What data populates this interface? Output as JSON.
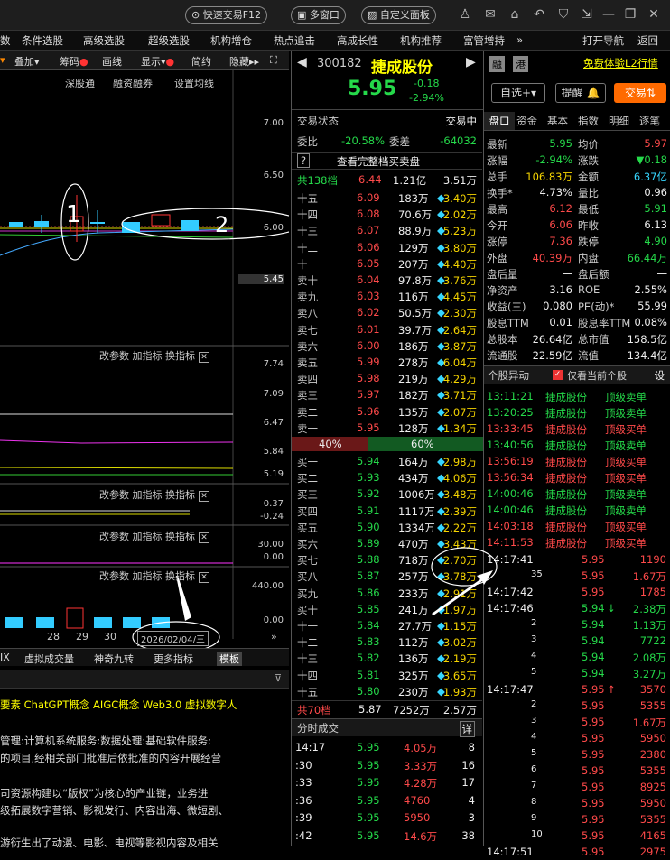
{
  "topbar": {
    "quick_trade": "快速交易F12",
    "multi_window": "多窗口",
    "custom_panel": "自定义面板"
  },
  "menu": [
    "数",
    "条件选股",
    "高级选股",
    "超级选股",
    "机构增仓",
    "热点追击",
    "高成长性",
    "机构推荐",
    "富管增持",
    "»",
    "打开导航",
    "返回"
  ],
  "chartbar": {
    "overlay": "叠加",
    "chips": "筹码",
    "draw": "画线",
    "display": "显示",
    "simple": "简约",
    "hide": "隐藏"
  },
  "chart": {
    "sub_tabs": [
      "深股通",
      "融资融券",
      "设置均线"
    ],
    "price_labels": [
      "7.00",
      "6.50",
      "6.00",
      "5.45"
    ],
    "annot1": "1",
    "annot2": "2",
    "panel_ctrl": {
      "params": "改参数",
      "add": "加指标",
      "switch": "换指标"
    },
    "p2_labels": [
      "7.74",
      "7.09",
      "6.47",
      "5.84",
      "5.19"
    ],
    "p3_labels": [
      "0.37",
      "-0.24"
    ],
    "p4_labels": [
      "30.00",
      "0.00"
    ],
    "p5_labels": [
      "440.00",
      "0.00"
    ],
    "dates": [
      "28",
      "29",
      "30"
    ],
    "date_box": "2026/02/04/三",
    "model": "模板"
  },
  "bottom_tabs": [
    "IX",
    "虚拟成交量",
    "神奇九转",
    "更多指标",
    "模板"
  ],
  "news": [
    "要素 ChatGPT概念 AIGC概念 Web3.0 虚拟数字人",
    "管理:计算机系统服务:数据处理:基础软件服务:",
    "的项目,经相关部门批准后依批准的内容开展经营",
    "司资源构建以“版权”为核心的产业链，业务进",
    "级拓展数字营销、影视发行、内容出海、微短剧、",
    "游衍生出了动漫、电影、电视等影视内容及相关"
  ],
  "stock": {
    "code": "300182",
    "name": "捷成股份",
    "price": "5.95",
    "change": "-0.18",
    "pct": "-2.94%",
    "tag1": "融",
    "tag2": "港",
    "l2": "免费体验L2行情",
    "watch": "自选+",
    "alert": "提醒",
    "trade": "交易"
  },
  "order_status": {
    "label": "交易状态",
    "value": "交易中",
    "wb_label": "委比",
    "wb": "-20.58%",
    "wc_label": "委差",
    "wc": "-64032",
    "full": "查看完整档买卖盘"
  },
  "sell_total": {
    "label": "共138档",
    "price": "6.44",
    "amt": "1.21亿",
    "vol": "3.51万"
  },
  "asks": [
    [
      "十五",
      "6.09",
      "183万",
      "3.40万"
    ],
    [
      "十四",
      "6.08",
      "70.6万",
      "2.02万"
    ],
    [
      "十三",
      "6.07",
      "88.9万",
      "5.23万"
    ],
    [
      "十二",
      "6.06",
      "129万",
      "3.80万"
    ],
    [
      "十一",
      "6.05",
      "207万",
      "4.40万"
    ],
    [
      "卖十",
      "6.04",
      "97.8万",
      "3.76万"
    ],
    [
      "卖九",
      "6.03",
      "116万",
      "4.45万"
    ],
    [
      "卖八",
      "6.02",
      "50.5万",
      "2.30万"
    ],
    [
      "卖七",
      "6.01",
      "39.7万",
      "2.64万"
    ],
    [
      "卖六",
      "6.00",
      "186万",
      "3.87万"
    ],
    [
      "卖五",
      "5.99",
      "278万",
      "6.04万"
    ],
    [
      "卖四",
      "5.98",
      "219万",
      "4.29万"
    ],
    [
      "卖三",
      "5.97",
      "182万",
      "3.71万"
    ],
    [
      "卖二",
      "5.96",
      "135万",
      "2.07万"
    ],
    [
      "卖一",
      "5.95",
      "128万",
      "1.34万"
    ]
  ],
  "ratio": {
    "sell": "40%",
    "buy": "60%",
    "sell_frac": 0.4
  },
  "bids": [
    [
      "买一",
      "5.94",
      "164万",
      "2.98万"
    ],
    [
      "买二",
      "5.93",
      "434万",
      "4.06万"
    ],
    [
      "买三",
      "5.92",
      "1006万",
      "3.48万"
    ],
    [
      "买四",
      "5.91",
      "1117万",
      "2.39万"
    ],
    [
      "买五",
      "5.90",
      "1334万",
      "2.22万"
    ],
    [
      "买六",
      "5.89",
      "470万",
      "3.43万"
    ],
    [
      "买七",
      "5.88",
      "718万",
      "2.70万"
    ],
    [
      "买八",
      "5.87",
      "257万",
      "3.78万"
    ],
    [
      "买九",
      "5.86",
      "233万",
      "2.91万"
    ],
    [
      "买十",
      "5.85",
      "241万",
      "1.97万"
    ],
    [
      "十一",
      "5.84",
      "27.7万",
      "1.15万"
    ],
    [
      "十二",
      "5.83",
      "112万",
      "3.02万"
    ],
    [
      "十三",
      "5.82",
      "136万",
      "2.19万"
    ],
    [
      "十四",
      "5.81",
      "325万",
      "3.65万"
    ],
    [
      "十五",
      "5.80",
      "230万",
      "1.93万"
    ]
  ],
  "buy_total": {
    "label": "共70档",
    "price": "5.87",
    "amt": "7252万",
    "vol": "2.57万"
  },
  "minute_trades": {
    "title": "分时成交",
    "detail": "详",
    "rows": [
      [
        "14:17",
        "5.95",
        "4.05万",
        "8"
      ],
      [
        ":30",
        "5.95",
        "3.33万",
        "16"
      ],
      [
        ":33",
        "5.95",
        "4.28万",
        "17"
      ],
      [
        ":36",
        "5.95",
        "4760",
        "4"
      ],
      [
        ":39",
        "5.95",
        "5950",
        "3"
      ],
      [
        ":42",
        "5.95",
        "14.6万",
        "38"
      ]
    ]
  },
  "right_tabs": [
    "盘口",
    "资金",
    "基本",
    "指数",
    "明细",
    "逐笔"
  ],
  "quote": [
    [
      "最新",
      "5.95",
      "均价",
      "5.97"
    ],
    [
      "涨幅",
      "-2.94%",
      "涨跌",
      "▼0.18"
    ],
    [
      "总手",
      "106.83万",
      "金额",
      "6.37亿"
    ],
    [
      "换手*",
      "4.73%",
      "量比",
      "0.96"
    ],
    [
      "最高",
      "6.12",
      "最低",
      "5.91"
    ],
    [
      "今开",
      "6.06",
      "昨收",
      "6.13"
    ],
    [
      "涨停",
      "7.36",
      "跌停",
      "4.90"
    ],
    [
      "外盘",
      "40.39万",
      "内盘",
      "66.44万"
    ],
    [
      "盘后量",
      "一",
      "盘后额",
      "一"
    ],
    [
      "净资产",
      "3.16",
      "ROE",
      "2.55%"
    ],
    [
      "收益(三)",
      "0.080",
      "PE(动)*",
      "55.99"
    ],
    [
      "股息TTM",
      "0.01",
      "股息率TTM",
      "0.08%"
    ],
    [
      "总股本",
      "26.64亿",
      "总市值",
      "158.5亿"
    ],
    [
      "流通股",
      "22.59亿",
      "流值",
      "134.4亿"
    ]
  ],
  "movement": {
    "title": "个股异动",
    "only": "仅看当前个股",
    "settings": "设",
    "rows": [
      [
        "13:11:21",
        "捷成股份",
        "顶级卖单",
        "g"
      ],
      [
        "13:20:25",
        "捷成股份",
        "顶级卖单",
        "g"
      ],
      [
        "13:33:45",
        "捷成股份",
        "顶级买单",
        "r"
      ],
      [
        "13:40:56",
        "捷成股份",
        "顶级卖单",
        "g"
      ],
      [
        "13:56:19",
        "捷成股份",
        "顶级买单",
        "r"
      ],
      [
        "13:56:34",
        "捷成股份",
        "顶级买单",
        "r"
      ],
      [
        "14:00:46",
        "捷成股份",
        "顶级卖单",
        "g"
      ],
      [
        "14:00:46",
        "捷成股份",
        "顶级卖单",
        "g"
      ],
      [
        "14:03:18",
        "捷成股份",
        "顶级买单",
        "r"
      ],
      [
        "14:11:53",
        "捷成股份",
        "顶级买单",
        "r"
      ]
    ]
  },
  "ticks": [
    [
      "14:17:41",
      "5.95",
      "1190",
      "r",
      ""
    ],
    [
      "35",
      "5.95",
      "1.67万",
      "r",
      ""
    ],
    [
      "14:17:42",
      "5.95",
      "1785",
      "r",
      ""
    ],
    [
      "14:17:46",
      "5.94",
      "2.38万",
      "g",
      "↓"
    ],
    [
      "2",
      "5.94",
      "1.13万",
      "g",
      ""
    ],
    [
      "3",
      "5.94",
      "7722",
      "g",
      ""
    ],
    [
      "4",
      "5.94",
      "2.08万",
      "g",
      ""
    ],
    [
      "5",
      "5.94",
      "3.27万",
      "g",
      ""
    ],
    [
      "14:17:47",
      "5.95",
      "3570",
      "r",
      "↑"
    ],
    [
      "2",
      "5.95",
      "5355",
      "r",
      ""
    ],
    [
      "3",
      "5.95",
      "1.67万",
      "r",
      ""
    ],
    [
      "4",
      "5.95",
      "5950",
      "r",
      ""
    ],
    [
      "5",
      "5.95",
      "2380",
      "r",
      ""
    ],
    [
      "6",
      "5.95",
      "5355",
      "r",
      ""
    ],
    [
      "7",
      "5.95",
      "8925",
      "r",
      ""
    ],
    [
      "8",
      "5.95",
      "5950",
      "r",
      ""
    ],
    [
      "9",
      "5.95",
      "5355",
      "r",
      ""
    ],
    [
      "10",
      "5.95",
      "4165",
      "r",
      ""
    ],
    [
      "14:17:51",
      "5.95",
      "2975",
      "r",
      ""
    ]
  ]
}
